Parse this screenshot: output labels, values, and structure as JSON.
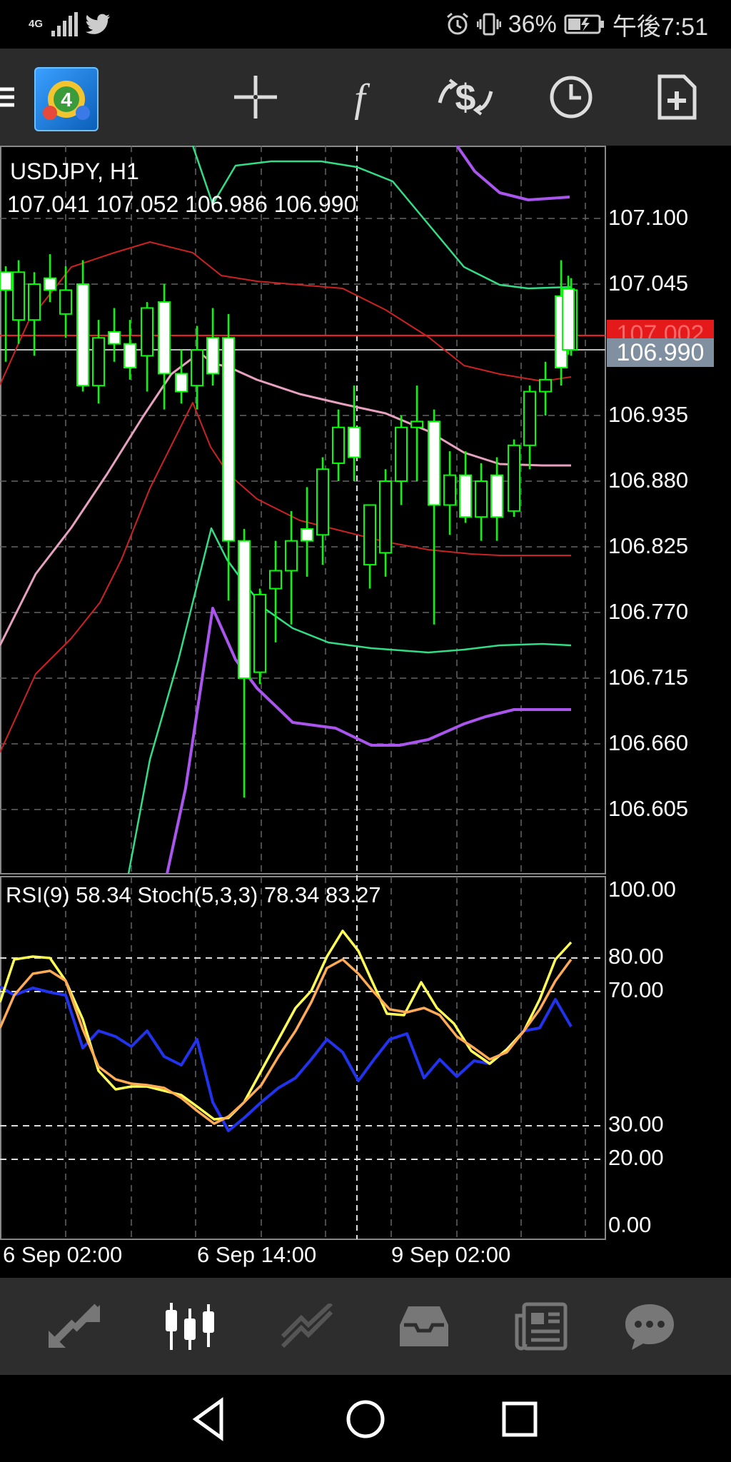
{
  "status_bar": {
    "network": "4G",
    "battery": "36%",
    "time": "午後7:51",
    "icons": [
      "signal-icon",
      "twitter-icon",
      "alarm-icon",
      "vibrate-icon",
      "battery-icon"
    ]
  },
  "toolbar": {
    "icons": [
      "menu-icon",
      "app-logo-icon",
      "crosshair-icon",
      "function-icon",
      "trade-icon",
      "timeframe-icon",
      "new-chart-icon"
    ]
  },
  "chart": {
    "symbol": "USDJPY, H1",
    "ohlc": "107.041 107.052 106.986 106.990",
    "price_labels": [
      "107.100",
      "107.045",
      "106.935",
      "106.880",
      "106.825",
      "106.770",
      "106.715",
      "106.660",
      "106.605"
    ],
    "red_tag": "107.002",
    "current_price": "106.990",
    "colors": {
      "bull": "#ffffff",
      "bear": "#00ff00",
      "bb_green": "#33dd88",
      "bb_purple": "#aa55ee",
      "bb_red": "#cc2222",
      "ma_pink": "#e8a0c0",
      "red_line": "#ff2020",
      "grey_line": "#bbbbbb"
    }
  },
  "indicator": {
    "header": "RSI(9) 58.34 Stoch(5,3,3) 78.34 83.27",
    "levels": [
      "100.00",
      "80.00",
      "70.00",
      "30.00",
      "20.00",
      "0.00"
    ],
    "colors": {
      "rsi": "#2233ee",
      "stoch_main": "#ffff55",
      "stoch_signal": "#ffaa55"
    }
  },
  "time_axis": [
    "6 Sep 02:00",
    "6 Sep 14:00",
    "9 Sep 02:00"
  ],
  "bottom_bar": {
    "icons": [
      "quotes-icon",
      "chart-icon",
      "trade-icon",
      "history-icon",
      "news-icon",
      "chat-icon"
    ],
    "active": "chart-icon"
  },
  "nav_bar": {
    "icons": [
      "back-icon",
      "home-icon",
      "recents-icon"
    ]
  }
}
